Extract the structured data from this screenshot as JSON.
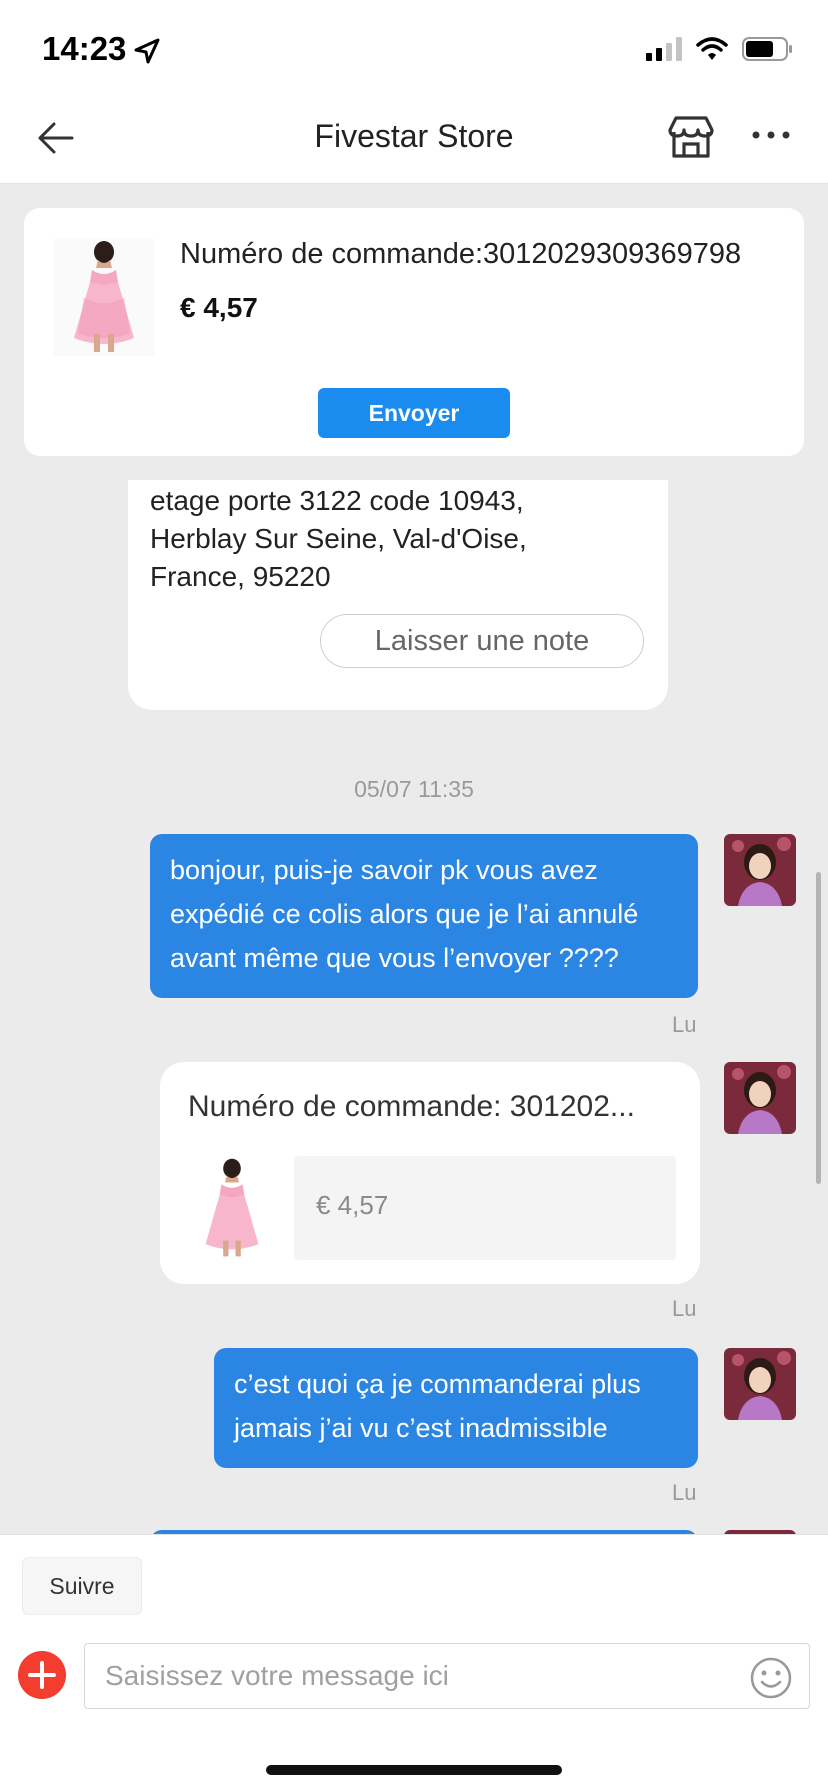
{
  "status_bar": {
    "time": "14:23"
  },
  "nav": {
    "title": "Fivestar Store",
    "icons": [
      "back-arrow-icon",
      "store-icon",
      "more-icon"
    ]
  },
  "order_header": {
    "order_number": "Numéro de commande:3012029309369798",
    "price": "€ 4,57",
    "send_label": "Envoyer"
  },
  "chat": {
    "address_text": "etage porte 3122 code 10943,\nHerblay Sur Seine, Val-d'Oise,\nFrance, 95220",
    "note_button": "Laisser une note",
    "timestamp": "05/07 11:35",
    "messages": [
      {
        "text": "bonjour, puis-je savoir pk vous avez expédié ce colis alors que je l’ai annulé avant même que vous l’envoyer ????",
        "status": "Lu"
      },
      {
        "order_title": "Numéro de commande: 301202...",
        "order_price": "€ 4,57",
        "status": "Lu"
      },
      {
        "text": "c’est quoi ça je commanderai plus jamais j’ai vu c’est inadmissible",
        "status": "Lu"
      }
    ]
  },
  "bottom": {
    "follow_label": "Suivre",
    "input_placeholder": "Saisissez votre message ici"
  },
  "colors": {
    "accent": "#1a8cf0",
    "bubble": "#2b86e3",
    "plus": "#f23d2f"
  }
}
